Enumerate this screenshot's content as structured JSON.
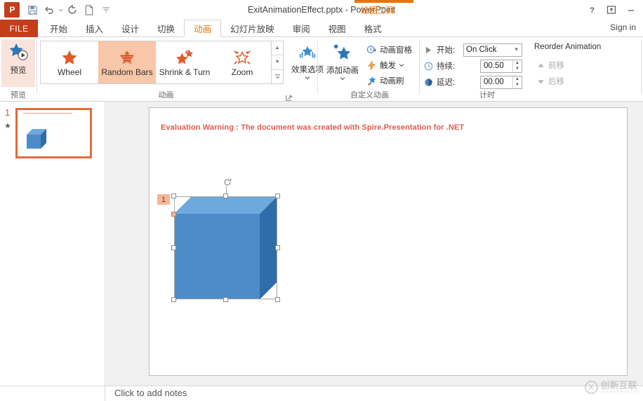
{
  "window": {
    "title": "ExitAnimationEffect.pptx - PowerPoint",
    "app_logo": "P",
    "contextual_tab_label": "绘图工具",
    "sign_in": "Sign in",
    "quick_access": [
      {
        "name": "save-icon",
        "label": "保存"
      },
      {
        "name": "undo-icon",
        "label": "撤消"
      },
      {
        "name": "redo-icon",
        "label": "重复"
      },
      {
        "name": "new-slide-icon",
        "label": "新建"
      },
      {
        "name": "customize-qat-icon",
        "label": "自定义快速访问工具栏"
      }
    ],
    "controls": [
      {
        "name": "help-icon",
        "glyph": "?"
      },
      {
        "name": "ribbon-display-options-icon",
        "glyph": "⇱"
      },
      {
        "name": "minimize-icon",
        "glyph": "—"
      }
    ]
  },
  "tabs": {
    "file": "FILE",
    "items": [
      {
        "label": "开始",
        "active": false
      },
      {
        "label": "插入",
        "active": false
      },
      {
        "label": "设计",
        "active": false
      },
      {
        "label": "切换",
        "active": false
      },
      {
        "label": "动画",
        "active": true
      },
      {
        "label": "幻灯片放映",
        "active": false
      },
      {
        "label": "审阅",
        "active": false
      },
      {
        "label": "视图",
        "active": false
      },
      {
        "label": "格式",
        "active": false
      }
    ]
  },
  "ribbon": {
    "preview_group": {
      "label": "预览",
      "button_label": "预览"
    },
    "animation_group": {
      "label": "动画",
      "gallery": [
        {
          "name": "Wheel",
          "selected": false
        },
        {
          "name": "Random Bars",
          "selected": true
        },
        {
          "name": "Shrink & Turn",
          "selected": false
        },
        {
          "name": "Zoom",
          "selected": false
        }
      ],
      "effect_options_label": "效果选项"
    },
    "custom_animation_group": {
      "label": "自定义动画",
      "add_animation_label": "添加动画",
      "commands": [
        {
          "label": "动画窗格",
          "icon": "animation-pane-icon"
        },
        {
          "label": "触发",
          "icon": "trigger-icon",
          "has_caret": true
        },
        {
          "label": "动画刷",
          "icon": "animation-painter-icon"
        }
      ]
    },
    "timing_group": {
      "label": "计时",
      "start_label": "开始:",
      "start_value": "On Click",
      "duration_label": "持续:",
      "duration_value": "00.50",
      "delay_label": "延迟:",
      "delay_value": "00.00"
    },
    "reorder_group": {
      "title": "Reorder Animation",
      "move_earlier": "前移",
      "move_later": "后移"
    }
  },
  "slide_panel": {
    "slide_number": "1",
    "animation_marker": "★"
  },
  "slide": {
    "evaluation_warning": "Evaluation Warning : The document was created with  Spire.Presentation for .NET",
    "shape": {
      "name": "cube-shape",
      "animation_order_badge": "1",
      "colors": {
        "front": "#4E8CC9",
        "top": "#6EA9DE",
        "right": "#2E6DA8"
      }
    }
  },
  "notes": {
    "placeholder": "Click to add notes"
  },
  "watermark": {
    "mark": "X",
    "chinese": "创新互联",
    "pinyin": "CHUANG XIN HU LIAN"
  },
  "theme": {
    "accent_orange": "#E8740C",
    "file_red": "#C43E1C",
    "selection_peach": "#F8C6A8",
    "warning_red": "#E05A4E"
  }
}
